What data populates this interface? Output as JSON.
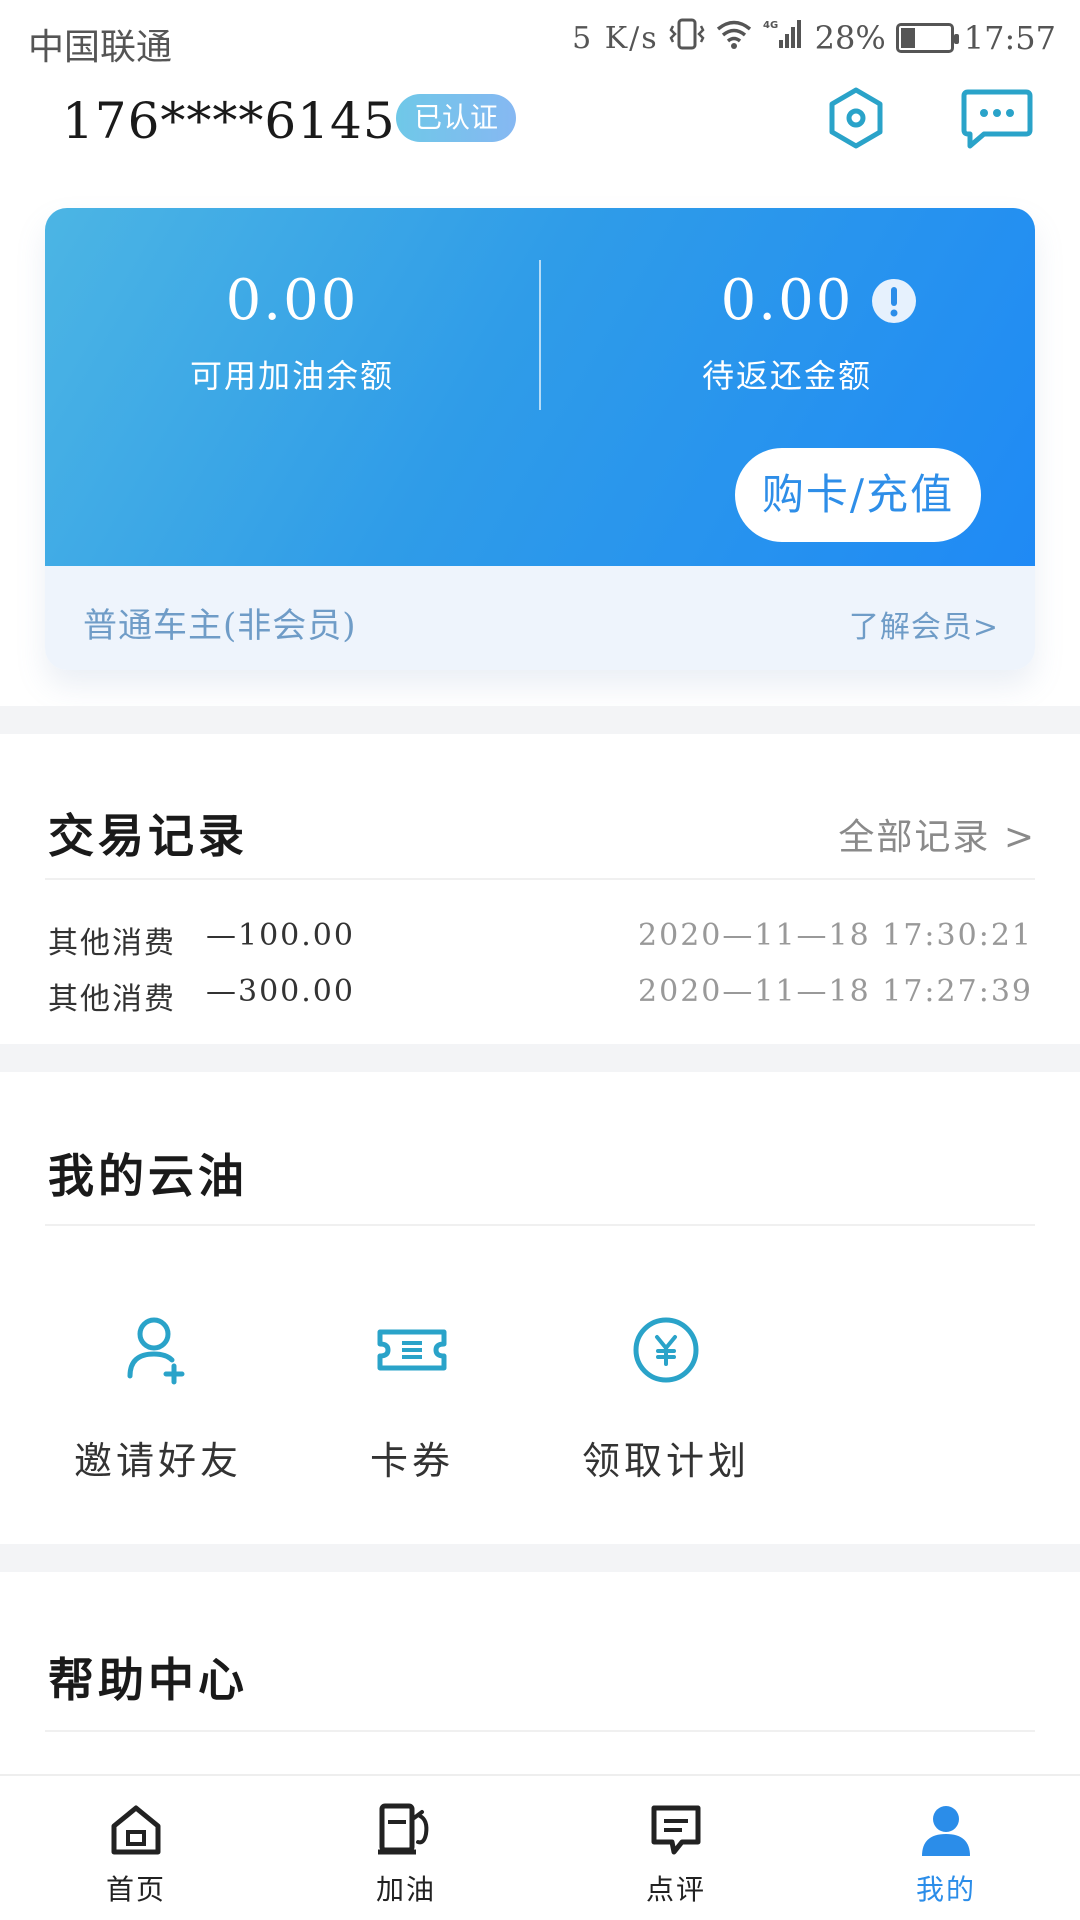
{
  "status_bar": {
    "carrier": "中国联通",
    "net_speed": "5 K/s",
    "network_type": "4G",
    "battery": "28%",
    "battery_level": 0.28,
    "time": "17:57"
  },
  "header": {
    "phone": "176****6145",
    "verified_badge": "已认证",
    "settings_icon": "settings-hex-icon",
    "message_icon": "chat-bubble-icon"
  },
  "card": {
    "available_amount": "0.00",
    "available_label": "可用加油余额",
    "pending_amount": "0.00",
    "pending_label": "待返还金额",
    "recharge_button": "购卡/充值",
    "member_type": "普通车主(非会员)",
    "member_link": "了解会员>"
  },
  "transactions": {
    "title": "交易记录",
    "all_records": "全部记录 >",
    "rows": [
      {
        "type": "其他消费",
        "amount": "—100.00",
        "time": "2020—11—18  17:30:21"
      },
      {
        "type": "其他消费",
        "amount": "—300.00",
        "time": "2020—11—18  17:27:39"
      }
    ]
  },
  "my_oil": {
    "title": "我的云油",
    "items": [
      {
        "label": "邀请好友",
        "icon": "add-user-icon"
      },
      {
        "label": "卡券",
        "icon": "ticket-icon"
      },
      {
        "label": "领取计划",
        "icon": "yen-coin-icon"
      }
    ]
  },
  "help": {
    "title": "帮助中心"
  },
  "bottom_nav": {
    "items": [
      {
        "label": "首页",
        "icon": "home-icon"
      },
      {
        "label": "加油",
        "icon": "fuel-pump-icon"
      },
      {
        "label": "点评",
        "icon": "comment-icon"
      },
      {
        "label": "我的",
        "icon": "user-icon",
        "active": true
      }
    ]
  },
  "colors": {
    "accent": "#2b8de9",
    "card_gradient_start": "#4cb5e4",
    "card_gradient_end": "#1f8af5",
    "icon_teal": "#2aa3c9"
  }
}
